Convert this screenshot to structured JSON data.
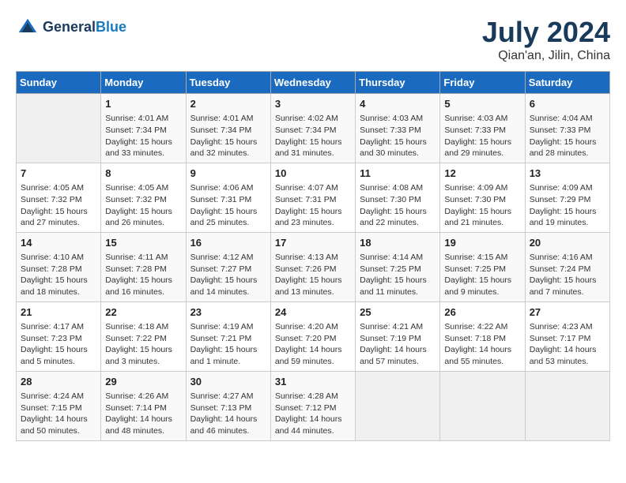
{
  "header": {
    "logo_general": "General",
    "logo_blue": "Blue",
    "month": "July 2024",
    "location": "Qian'an, Jilin, China"
  },
  "weekdays": [
    "Sunday",
    "Monday",
    "Tuesday",
    "Wednesday",
    "Thursday",
    "Friday",
    "Saturday"
  ],
  "weeks": [
    [
      {
        "empty": true
      },
      {
        "day": 1,
        "sunrise": "4:01 AM",
        "sunset": "7:34 PM",
        "daylight": "15 hours and 33 minutes."
      },
      {
        "day": 2,
        "sunrise": "4:01 AM",
        "sunset": "7:34 PM",
        "daylight": "15 hours and 32 minutes."
      },
      {
        "day": 3,
        "sunrise": "4:02 AM",
        "sunset": "7:34 PM",
        "daylight": "15 hours and 31 minutes."
      },
      {
        "day": 4,
        "sunrise": "4:03 AM",
        "sunset": "7:33 PM",
        "daylight": "15 hours and 30 minutes."
      },
      {
        "day": 5,
        "sunrise": "4:03 AM",
        "sunset": "7:33 PM",
        "daylight": "15 hours and 29 minutes."
      },
      {
        "day": 6,
        "sunrise": "4:04 AM",
        "sunset": "7:33 PM",
        "daylight": "15 hours and 28 minutes."
      }
    ],
    [
      {
        "day": 7,
        "sunrise": "4:05 AM",
        "sunset": "7:32 PM",
        "daylight": "15 hours and 27 minutes."
      },
      {
        "day": 8,
        "sunrise": "4:05 AM",
        "sunset": "7:32 PM",
        "daylight": "15 hours and 26 minutes."
      },
      {
        "day": 9,
        "sunrise": "4:06 AM",
        "sunset": "7:31 PM",
        "daylight": "15 hours and 25 minutes."
      },
      {
        "day": 10,
        "sunrise": "4:07 AM",
        "sunset": "7:31 PM",
        "daylight": "15 hours and 23 minutes."
      },
      {
        "day": 11,
        "sunrise": "4:08 AM",
        "sunset": "7:30 PM",
        "daylight": "15 hours and 22 minutes."
      },
      {
        "day": 12,
        "sunrise": "4:09 AM",
        "sunset": "7:30 PM",
        "daylight": "15 hours and 21 minutes."
      },
      {
        "day": 13,
        "sunrise": "4:09 AM",
        "sunset": "7:29 PM",
        "daylight": "15 hours and 19 minutes."
      }
    ],
    [
      {
        "day": 14,
        "sunrise": "4:10 AM",
        "sunset": "7:28 PM",
        "daylight": "15 hours and 18 minutes."
      },
      {
        "day": 15,
        "sunrise": "4:11 AM",
        "sunset": "7:28 PM",
        "daylight": "15 hours and 16 minutes."
      },
      {
        "day": 16,
        "sunrise": "4:12 AM",
        "sunset": "7:27 PM",
        "daylight": "15 hours and 14 minutes."
      },
      {
        "day": 17,
        "sunrise": "4:13 AM",
        "sunset": "7:26 PM",
        "daylight": "15 hours and 13 minutes."
      },
      {
        "day": 18,
        "sunrise": "4:14 AM",
        "sunset": "7:25 PM",
        "daylight": "15 hours and 11 minutes."
      },
      {
        "day": 19,
        "sunrise": "4:15 AM",
        "sunset": "7:25 PM",
        "daylight": "15 hours and 9 minutes."
      },
      {
        "day": 20,
        "sunrise": "4:16 AM",
        "sunset": "7:24 PM",
        "daylight": "15 hours and 7 minutes."
      }
    ],
    [
      {
        "day": 21,
        "sunrise": "4:17 AM",
        "sunset": "7:23 PM",
        "daylight": "15 hours and 5 minutes."
      },
      {
        "day": 22,
        "sunrise": "4:18 AM",
        "sunset": "7:22 PM",
        "daylight": "15 hours and 3 minutes."
      },
      {
        "day": 23,
        "sunrise": "4:19 AM",
        "sunset": "7:21 PM",
        "daylight": "15 hours and 1 minute."
      },
      {
        "day": 24,
        "sunrise": "4:20 AM",
        "sunset": "7:20 PM",
        "daylight": "14 hours and 59 minutes."
      },
      {
        "day": 25,
        "sunrise": "4:21 AM",
        "sunset": "7:19 PM",
        "daylight": "14 hours and 57 minutes."
      },
      {
        "day": 26,
        "sunrise": "4:22 AM",
        "sunset": "7:18 PM",
        "daylight": "14 hours and 55 minutes."
      },
      {
        "day": 27,
        "sunrise": "4:23 AM",
        "sunset": "7:17 PM",
        "daylight": "14 hours and 53 minutes."
      }
    ],
    [
      {
        "day": 28,
        "sunrise": "4:24 AM",
        "sunset": "7:15 PM",
        "daylight": "14 hours and 50 minutes."
      },
      {
        "day": 29,
        "sunrise": "4:26 AM",
        "sunset": "7:14 PM",
        "daylight": "14 hours and 48 minutes."
      },
      {
        "day": 30,
        "sunrise": "4:27 AM",
        "sunset": "7:13 PM",
        "daylight": "14 hours and 46 minutes."
      },
      {
        "day": 31,
        "sunrise": "4:28 AM",
        "sunset": "7:12 PM",
        "daylight": "14 hours and 44 minutes."
      },
      {
        "empty": true
      },
      {
        "empty": true
      },
      {
        "empty": true
      }
    ]
  ]
}
